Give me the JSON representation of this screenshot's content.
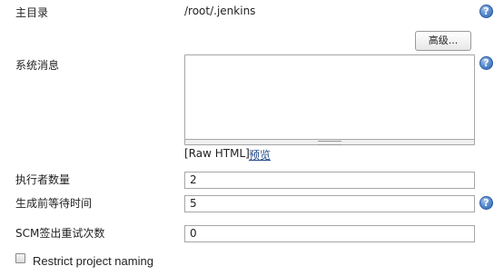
{
  "fields": {
    "home_dir": {
      "label": "主目录",
      "value": "/root/.jenkins"
    },
    "advanced_button": "高级...",
    "system_message": {
      "label": "系统消息",
      "value": ""
    },
    "raw_html_label": "[Raw HTML]",
    "preview_link": "预览",
    "executors": {
      "label": "执行者数量",
      "value": "2"
    },
    "quiet_period": {
      "label": "生成前等待时间",
      "value": "5"
    },
    "scm_retry": {
      "label": "SCM签出重试次数",
      "value": "0"
    },
    "restrict_naming": {
      "label": "Restrict project naming",
      "checked": false
    }
  },
  "help_glyph": "?",
  "icons": {
    "help": "help-icon"
  }
}
